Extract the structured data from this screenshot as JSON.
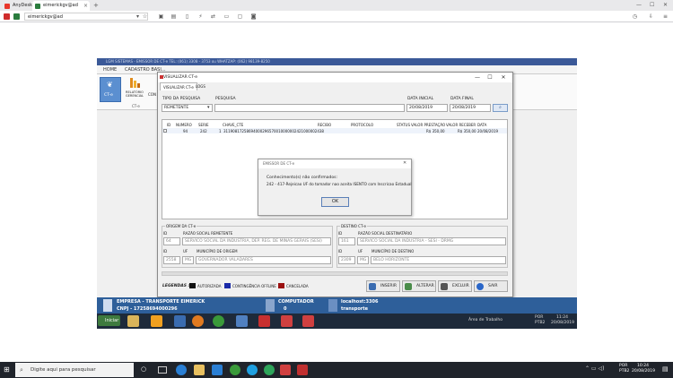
{
  "browser": {
    "tabs": [
      "AnyDesk",
      "eimerickgv@ad"
    ],
    "address": "eimerickgv@ad"
  },
  "remote": {
    "title": "LGM SISTEMAS - EMISSOR DE CT-e  TEL: (061) 3308 - 3753 ou WHATZAP: (062) 98139-8250",
    "menu": [
      "HOME",
      "CADASTRO BASI...",
      "CON..."
    ],
    "ribbon": {
      "cte": "CT-e",
      "relatorio": "RELATÓRIO GERENCIAL",
      "group_label": "CT-e",
      "con": "CON"
    }
  },
  "dialog": {
    "title": "VISUALIZAR CT-e",
    "tabs": [
      "VISUALIZAR CT-e",
      "LOGS"
    ],
    "labels": {
      "tipo_pesquisa": "TIPO DA PESQUISA",
      "pesquisa": "PESQUISA",
      "data_inicial": "DATA INICIAL",
      "data_final": "DATA FINAL"
    },
    "tipo_value": "REMETENTE",
    "data_inicial_value": "20/08/2019",
    "data_final_value": "20/08/2019",
    "grid": {
      "headers": [
        "ID",
        "NUMERO",
        "SERIE",
        "CHAVE_CTE",
        "RECIBO",
        "PROTOCOLO",
        "STATUS",
        "VALOR PRESTAÇÃO",
        "VALOR RECEBER",
        "DATA"
      ],
      "rows": [
        {
          "id": "",
          "numero": "94",
          "serie": "242",
          "chave_num": "1",
          "chave": "31190817258694000296570010000002421000002438",
          "recibo": "",
          "protocolo": "",
          "status": "",
          "valor_prestacao": "R$ 350,00",
          "valor_receber": "R$ 350,00",
          "data": "20/08/2019"
        }
      ]
    },
    "origem": {
      "group_label": "ORIGEM DA CT-e",
      "id_label": "ID",
      "razao_label": "RAZÃO SOCIAL REMETENTE",
      "id_value": "64",
      "razao_value": "SERVICO SOCIAL DA INDUSTRIA, DEP. REG. DE MINAS GERAIS (SESI)",
      "id2_label": "ID",
      "uf_label": "UF",
      "mun_label": "MUNICÍPIO DE ORIGEM",
      "id2_value": "2558",
      "uf_value": "MG",
      "mun_value": "GOVERNADOR VALADARES"
    },
    "destino": {
      "group_label": "DESTINO CT-e",
      "id_label": "ID",
      "razao_label": "RAZÃO SOCIAL DESTINATÁRIO",
      "id_value": "161",
      "razao_value": "SERVICO SOCIAL DA INDUSTRIA - SESI - DRMG",
      "id2_label": "ID",
      "uf_label": "UF",
      "mun_label": "MUNICÍPIO DE DESTINO",
      "id2_value": "2309",
      "uf_value": "MG",
      "mun_value": "BELO HORIZONTE"
    },
    "legend": {
      "title": "LEGENDAS :",
      "items": [
        {
          "label": "AUTORIZADA",
          "color": "#111111"
        },
        {
          "label": "CONTINGÊNCIA OFFLINE",
          "color": "#1a2aa8"
        },
        {
          "label": "CANCELADA",
          "color": "#9b1111"
        }
      ]
    },
    "buttons": [
      "INSERIR",
      "ALTERAR",
      "EXCLUIR",
      "SAIR"
    ]
  },
  "message": {
    "title": "EMISSOR DE CT-e",
    "line1": "Conhecimento(s) não confirmados:",
    "line2": "242 - 417-Rejeicao UF do tomador nao aceita ISENTO com Inscricao Estadual",
    "ok": "OK"
  },
  "status_strip": {
    "empresa": "EMPRESA - TRANSPORTE EIMERICK",
    "cnpj": "CNPJ - 17258694000296",
    "computador_label": "COMPUTADOR",
    "computador_value": "0",
    "server": "localhost:3306",
    "server_label": "transporte"
  },
  "remote_taskbar": {
    "start": "Iniciar",
    "area": "Área de Trabalho",
    "lang": "POR",
    "lang2": "PTB2",
    "time": "11:24",
    "date": "20/08/2019"
  },
  "host_taskbar": {
    "search_placeholder": "Digite aqui para pesquisar",
    "lang": "POR",
    "lang2": "PTB2",
    "time": "10:24",
    "date": "20/08/2019"
  }
}
